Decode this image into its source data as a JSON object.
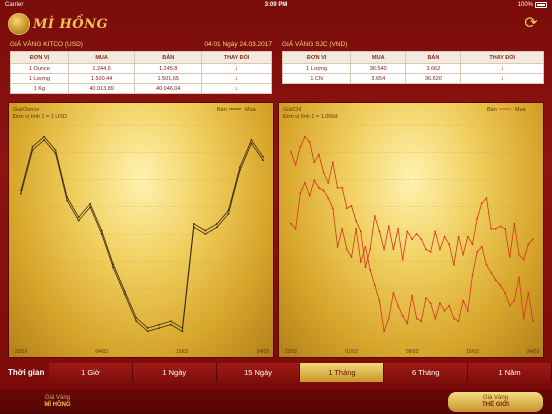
{
  "status": {
    "carrier": "Carrier",
    "time": "3:09 PM",
    "battery": "100%"
  },
  "app": {
    "title": "MÌ HỒNG"
  },
  "kitco": {
    "title": "GIÁ VÀNG KITCO (USD)",
    "datetime": "04:01 Ngày 24.03.2017",
    "headers": [
      "ĐƠN VỊ",
      "MUA",
      "BÁN",
      "THAY ĐỔI"
    ],
    "rows": [
      [
        "1 Ounce",
        "1.244,6",
        "1.245,8",
        "↓"
      ],
      [
        "1 Lượng",
        "1.500,44",
        "1.501,65",
        "↓"
      ],
      [
        "1 Kg",
        "40.013,89",
        "40.046,04",
        "↓"
      ]
    ]
  },
  "sjc": {
    "title": "GIÁ VÀNG SJC (VND)",
    "headers": [
      "ĐƠN VỊ",
      "MUA",
      "BÁN",
      "THAY ĐỔI"
    ],
    "rows": [
      [
        "1 Lượng",
        "36.540",
        "3.662",
        "↓"
      ],
      [
        "1 CN",
        "3.654",
        "36.620",
        "↓"
      ]
    ]
  },
  "chart_data": [
    {
      "type": "line",
      "ylabel": "Giá/Ounce",
      "unit_note": "Đơn vị tính 1 = 1 USD",
      "legend": [
        "Bán",
        "Mua"
      ],
      "x_ticks": [
        "23/02",
        "04/03",
        "15/03",
        "24/03"
      ],
      "series": [
        {
          "name": "Bán",
          "color": "#3a2a10",
          "values": [
            1250,
            1263,
            1266,
            1262,
            1248,
            1242,
            1246,
            1238,
            1228,
            1220,
            1212,
            1209,
            1210,
            1211,
            1209,
            1240,
            1238,
            1240,
            1244,
            1257,
            1265,
            1260
          ]
        },
        {
          "name": "Mua",
          "color": "#3a2a10",
          "values": [
            1249,
            1262,
            1265,
            1261,
            1247,
            1241,
            1245,
            1237,
            1227,
            1219,
            1211,
            1208,
            1209,
            1210,
            1208,
            1239,
            1237,
            1239,
            1243,
            1256,
            1264,
            1259
          ]
        }
      ]
    },
    {
      "type": "line",
      "ylabel": "Giá/Chỉ",
      "unit_note": "Đơn vị tính 1 = 1.000đ",
      "legend": [
        "Bán",
        "Mua"
      ],
      "x_ticks": [
        "23/02",
        "01/03",
        "08/03",
        "15/03",
        "24/03"
      ],
      "series": [
        {
          "name": "Bán",
          "color": "#d4361c",
          "values": [
            3710,
            3705,
            3712,
            3716,
            3714,
            3706,
            3709,
            3702,
            3698,
            3706,
            3696,
            3696,
            3688,
            3689,
            3683,
            3679,
            3665,
            3672,
            3685,
            3679,
            3672,
            3681,
            3672,
            3680,
            3668,
            3679,
            3676,
            3678,
            3676,
            3672,
            3671,
            3679,
            3672,
            3677,
            3674,
            3666,
            3677,
            3670,
            3677,
            3674,
            3684,
            3690,
            3692,
            3680,
            3680,
            3681,
            3680,
            3669,
            3682,
            3670,
            3668,
            3674,
            3676
          ]
        },
        {
          "name": "Mua",
          "color": "#d4361c",
          "values": [
            3682,
            3680,
            3694,
            3698,
            3693,
            3699,
            3696,
            3695,
            3692,
            3688,
            3673,
            3680,
            3672,
            3669,
            3680,
            3667,
            3673,
            3664,
            3658,
            3652,
            3640,
            3645,
            3655,
            3650,
            3646,
            3643,
            3654,
            3645,
            3644,
            3653,
            3651,
            3645,
            3651,
            3648,
            3650,
            3645,
            3644,
            3652,
            3648,
            3662,
            3671,
            3673,
            3666,
            3663,
            3660,
            3658,
            3655,
            3650,
            3652,
            3661,
            3645,
            3655,
            3644
          ]
        }
      ]
    }
  ],
  "timeframe": {
    "label": "Thời gian",
    "tabs": [
      "1 Giờ",
      "1 Ngày",
      "15 Ngày",
      "1 Tháng",
      "6 Tháng",
      "1 Năm"
    ],
    "active": 3
  },
  "bottom_tabs": [
    {
      "sub": "Giá Vàng",
      "main": "MÌ HỒNG"
    },
    {
      "sub": "Giá Vàng",
      "main": "THẾ GIỚI"
    }
  ]
}
